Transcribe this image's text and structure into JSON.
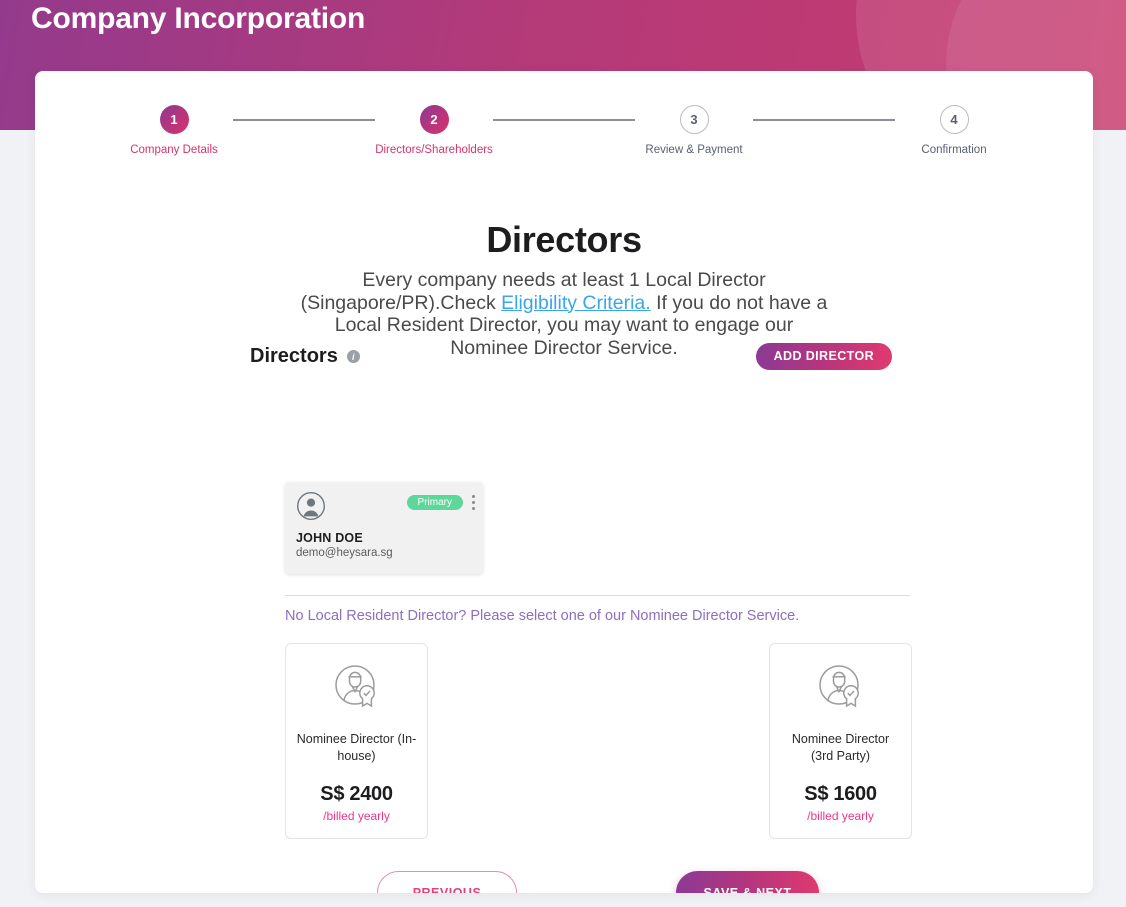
{
  "header": {
    "title": "Company Incorporation"
  },
  "stepper": {
    "steps": [
      {
        "number": "1",
        "label": "Company Details",
        "state": "active"
      },
      {
        "number": "2",
        "label": "Directors/Shareholders",
        "state": "active"
      },
      {
        "number": "3",
        "label": "Review & Payment",
        "state": "inactive"
      },
      {
        "number": "4",
        "label": "Confirmation",
        "state": "inactive"
      }
    ]
  },
  "main": {
    "title": "Directors",
    "subtitle_part1": "Every company needs at least 1 Local Director (Singapore/PR).Check ",
    "subtitle_link": "Eligibility Criteria.",
    "subtitle_part2": " If you do not have a Local Resident Director, you may want to engage our Nominee Director Service."
  },
  "directors_section": {
    "title": "Directors",
    "info_icon": "info-icon",
    "add_button_label": "ADD DIRECTOR",
    "cards": [
      {
        "avatar_icon": "avatar-icon",
        "badge": "Primary",
        "menu_icon": "kebab-menu-icon",
        "name": "JOHN DOE",
        "email": "demo@heysara.sg"
      }
    ]
  },
  "nominee_section": {
    "prompt": "No Local Resident Director? Please select one of our Nominee Director Service.",
    "options": [
      {
        "icon": "nominee-director-icon",
        "label": "Nominee Director (In-house)",
        "price": "S$ 2400",
        "billing": "/billed yearly"
      },
      {
        "icon": "nominee-director-icon",
        "label": "Nominee Director (3rd Party)",
        "price": "S$ 1600",
        "billing": "/billed yearly"
      }
    ]
  },
  "footer": {
    "previous_label": "PREVIOUS",
    "next_label": "SAVE & NEXT"
  },
  "colors": {
    "brand_purple": "#8a3a96",
    "brand_pink": "#d8336a",
    "link_blue": "#38a6e8",
    "badge_green": "#5ed79a",
    "nominee_purple": "#8b6fc0",
    "billing_pink": "#f0368a"
  }
}
